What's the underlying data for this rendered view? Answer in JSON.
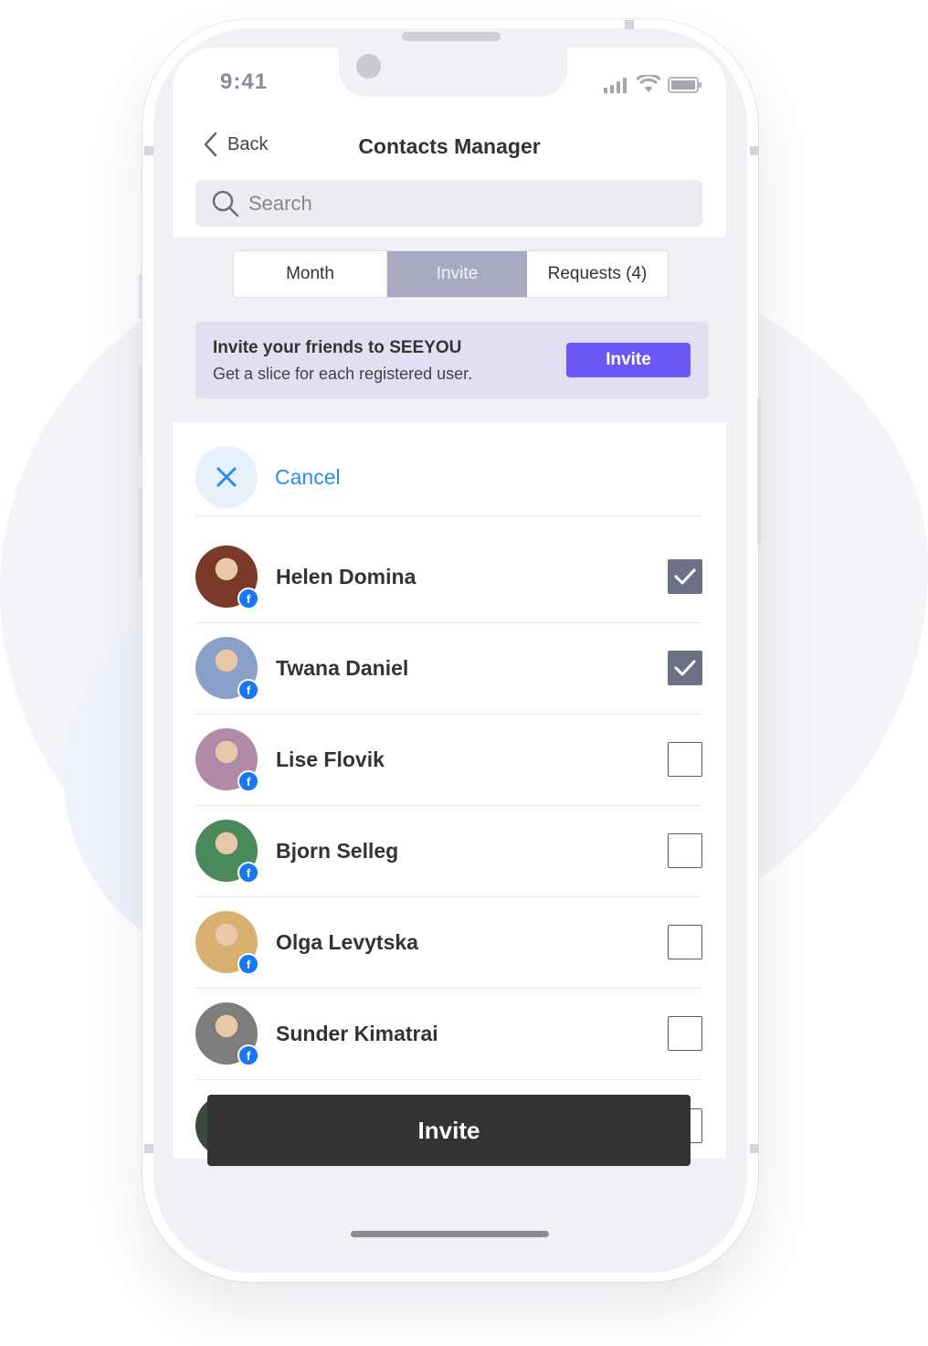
{
  "status_bar": {
    "time": "9:41"
  },
  "header": {
    "back_label": "Back",
    "title": "Contacts Manager"
  },
  "search": {
    "placeholder": "Search"
  },
  "tabs": [
    {
      "label": "Month",
      "active": false
    },
    {
      "label": "Invite",
      "active": true
    },
    {
      "label": "Requests (4)",
      "active": false
    }
  ],
  "banner": {
    "title": "Invite your friends to SEEYOU",
    "subtitle": "Get a slice for each registered user.",
    "button_label": "Invite"
  },
  "cancel_label": "Cancel",
  "contacts": [
    {
      "name": "Helen Domina",
      "checked": true,
      "avatar_color": "#7a3a2a"
    },
    {
      "name": "Twana Daniel",
      "checked": true,
      "avatar_color": "#8aa0c8"
    },
    {
      "name": "Lise Flovik",
      "checked": false,
      "avatar_color": "#b08aa6"
    },
    {
      "name": "Bjorn Selleg",
      "checked": false,
      "avatar_color": "#4a8a5a"
    },
    {
      "name": "Olga Levytska",
      "checked": false,
      "avatar_color": "#d8b070"
    },
    {
      "name": "Sunder Kimatrai",
      "checked": false,
      "avatar_color": "#7d7d7d"
    }
  ],
  "invite_button_label": "Invite",
  "colors": {
    "accent": "#6d58f5",
    "cancel_blue": "#2e8bea",
    "facebook": "#1877f2",
    "checked": "#6d7186"
  }
}
